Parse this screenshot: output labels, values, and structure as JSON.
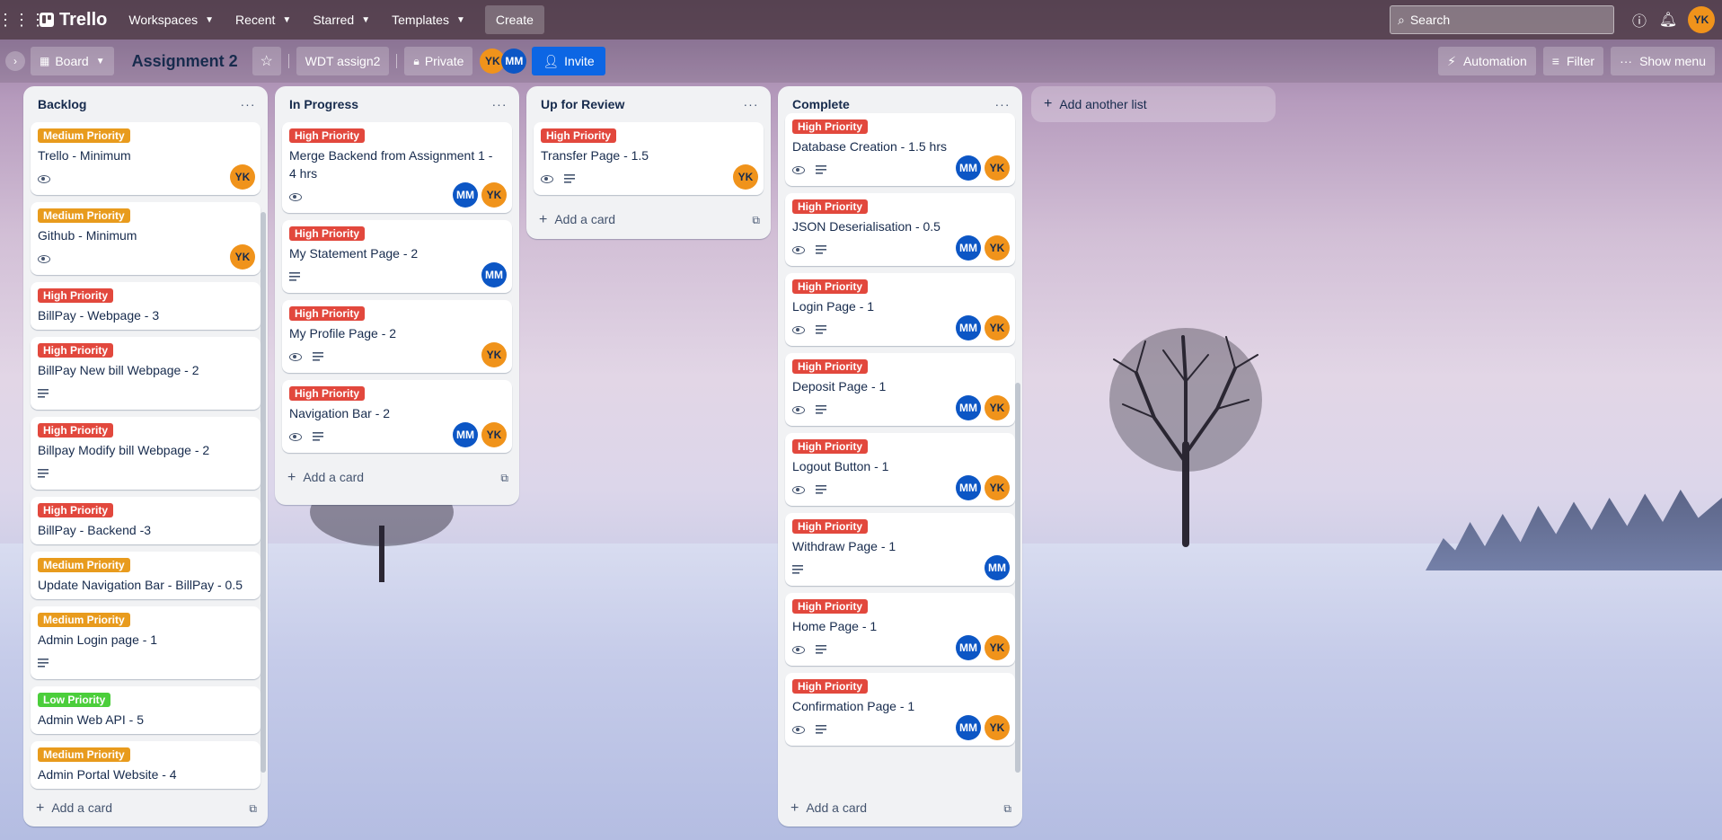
{
  "topnav": {
    "logo": "Trello",
    "menus": [
      "Workspaces",
      "Recent",
      "Starred",
      "Templates"
    ],
    "create": "Create",
    "search_placeholder": "Search",
    "user_initials": "YK"
  },
  "board": {
    "view": "Board",
    "title": "Assignment 2",
    "workspace": "WDT assign2",
    "visibility": "Private",
    "members": [
      "YK",
      "MM"
    ],
    "invite": "Invite",
    "automation": "Automation",
    "filter": "Filter",
    "show_menu": "Show menu",
    "add_list": "Add another list",
    "add_card": "Add a card"
  },
  "colors": {
    "high": "#e2483d",
    "medium": "#e89b1d",
    "low": "#4bce3b",
    "yk": "#f0931b",
    "mm": "#0c56c5",
    "invite": "#0c66e4"
  },
  "lists": [
    {
      "title": "Backlog",
      "cards": [
        {
          "label": "Medium Priority",
          "title": "Trello - Minimum",
          "watch": true,
          "desc": false,
          "members": [
            "YK"
          ]
        },
        {
          "label": "Medium Priority",
          "title": "Github - Minimum",
          "watch": true,
          "desc": false,
          "members": [
            "YK"
          ]
        },
        {
          "label": "High Priority",
          "title": "BillPay - Webpage - 3",
          "watch": false,
          "desc": false,
          "members": []
        },
        {
          "label": "High Priority",
          "title": "BillPay New bill Webpage - 2",
          "watch": false,
          "desc": true,
          "members": []
        },
        {
          "label": "High Priority",
          "title": "Billpay Modify bill Webpage - 2",
          "watch": false,
          "desc": true,
          "members": []
        },
        {
          "label": "High Priority",
          "title": "BillPay - Backend -3",
          "watch": false,
          "desc": false,
          "members": []
        },
        {
          "label": "Medium Priority",
          "title": "Update Navigation Bar - BillPay - 0.5",
          "watch": false,
          "desc": false,
          "members": []
        },
        {
          "label": "Medium Priority",
          "title": "Admin Login page - 1",
          "watch": false,
          "desc": true,
          "members": []
        },
        {
          "label": "Low Priority",
          "title": "Admin Web API - 5",
          "watch": false,
          "desc": false,
          "members": []
        },
        {
          "label": "Medium Priority",
          "title": "Admin Portal Website - 4",
          "watch": false,
          "desc": false,
          "members": []
        }
      ]
    },
    {
      "title": "In Progress",
      "cards": [
        {
          "label": "High Priority",
          "title": "Merge Backend from Assignment 1 - 4 hrs",
          "watch": true,
          "desc": false,
          "members": [
            "MM",
            "YK"
          ]
        },
        {
          "label": "High Priority",
          "title": "My Statement Page - 2",
          "watch": false,
          "desc": true,
          "members": [
            "MM"
          ]
        },
        {
          "label": "High Priority",
          "title": "My Profile Page - 2",
          "watch": true,
          "desc": true,
          "members": [
            "YK"
          ]
        },
        {
          "label": "High Priority",
          "title": "Navigation Bar - 2",
          "watch": true,
          "desc": true,
          "members": [
            "MM",
            "YK"
          ]
        }
      ]
    },
    {
      "title": "Up for Review",
      "cards": [
        {
          "label": "High Priority",
          "title": "Transfer Page - 1.5",
          "watch": true,
          "desc": true,
          "members": [
            "YK"
          ]
        }
      ]
    },
    {
      "title": "Complete",
      "cards": [
        {
          "label": "High Priority",
          "title": "Database Creation - 1.5 hrs",
          "watch": true,
          "desc": true,
          "members": [
            "MM",
            "YK"
          ]
        },
        {
          "label": "High Priority",
          "title": "JSON Deserialisation - 0.5",
          "watch": true,
          "desc": true,
          "members": [
            "MM",
            "YK"
          ]
        },
        {
          "label": "High Priority",
          "title": "Login Page - 1",
          "watch": true,
          "desc": true,
          "members": [
            "MM",
            "YK"
          ]
        },
        {
          "label": "High Priority",
          "title": "Deposit Page - 1",
          "watch": true,
          "desc": true,
          "members": [
            "MM",
            "YK"
          ]
        },
        {
          "label": "High Priority",
          "title": "Logout Button - 1",
          "watch": true,
          "desc": true,
          "members": [
            "MM",
            "YK"
          ]
        },
        {
          "label": "High Priority",
          "title": "Withdraw Page - 1",
          "watch": false,
          "desc": true,
          "members": [
            "MM"
          ]
        },
        {
          "label": "High Priority",
          "title": "Home Page - 1",
          "watch": true,
          "desc": true,
          "members": [
            "MM",
            "YK"
          ]
        },
        {
          "label": "High Priority",
          "title": "Confirmation Page - 1",
          "watch": true,
          "desc": true,
          "members": [
            "MM",
            "YK"
          ]
        }
      ]
    }
  ]
}
